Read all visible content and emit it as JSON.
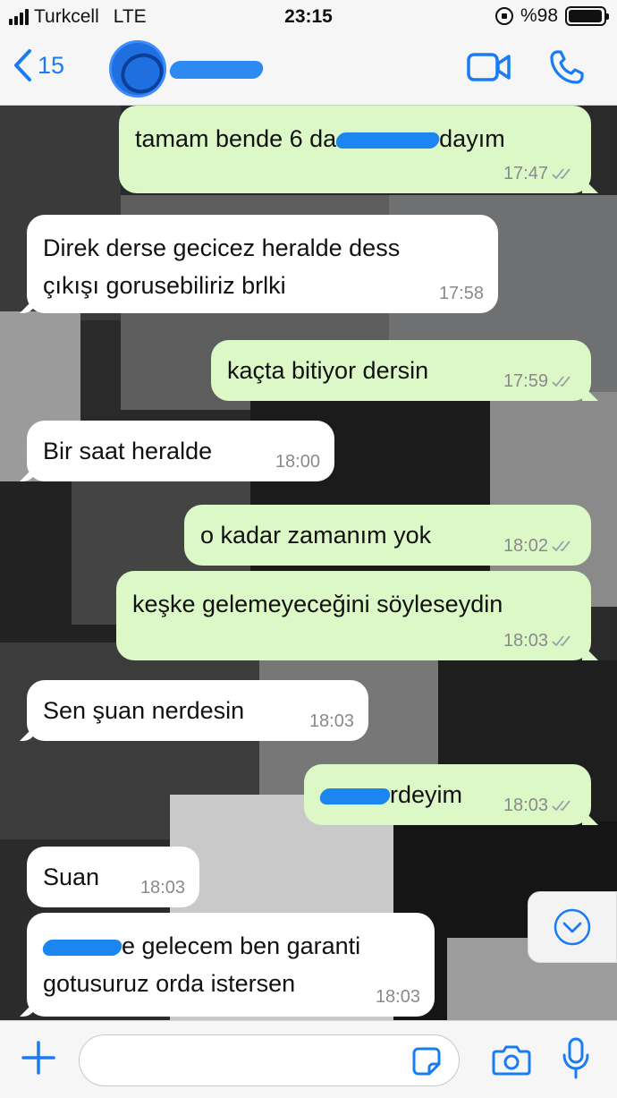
{
  "status_bar": {
    "carrier": "Turkcell",
    "network": "LTE",
    "time": "23:15",
    "battery": "%98",
    "battery_level": 0.98
  },
  "header": {
    "back_count": "15",
    "accent_color": "#1a7cf2"
  },
  "messages": [
    {
      "dir": "out",
      "pre": "tamam bende 6 da",
      "post": "dayım",
      "time": "17:47",
      "read": true
    },
    {
      "dir": "in",
      "line1": "Direk derse gecicez heralde dess",
      "line2": "çıkışı gorusebiliriz brlki",
      "time": "17:58"
    },
    {
      "dir": "out",
      "text": "kaçta bitiyor dersin",
      "time": "17:59",
      "read": true
    },
    {
      "dir": "in",
      "text": "Bir saat heralde",
      "time": "18:00"
    },
    {
      "dir": "out",
      "text": "o kadar zamanım yok",
      "time": "18:02",
      "read": true
    },
    {
      "dir": "out",
      "text": "keşke gelemeyeceğini söyleseydin",
      "time": "18:03",
      "read": true
    },
    {
      "dir": "in",
      "text": "Sen şuan nerdesin",
      "time": "18:03"
    },
    {
      "dir": "out",
      "post": "rdeyim",
      "time": "18:03",
      "read": true
    },
    {
      "dir": "in",
      "text": "Suan",
      "time": "18:03"
    },
    {
      "dir": "in",
      "line1_post": "e gelecem ben garanti",
      "line2": "gotusuruz orda istersen",
      "time": "18:03"
    }
  ],
  "input": {
    "placeholder": ""
  },
  "colors": {
    "outgoing_bubble": "#dcf8c6",
    "incoming_bubble": "#ffffff",
    "read_ticks": "#9aa0a6"
  }
}
